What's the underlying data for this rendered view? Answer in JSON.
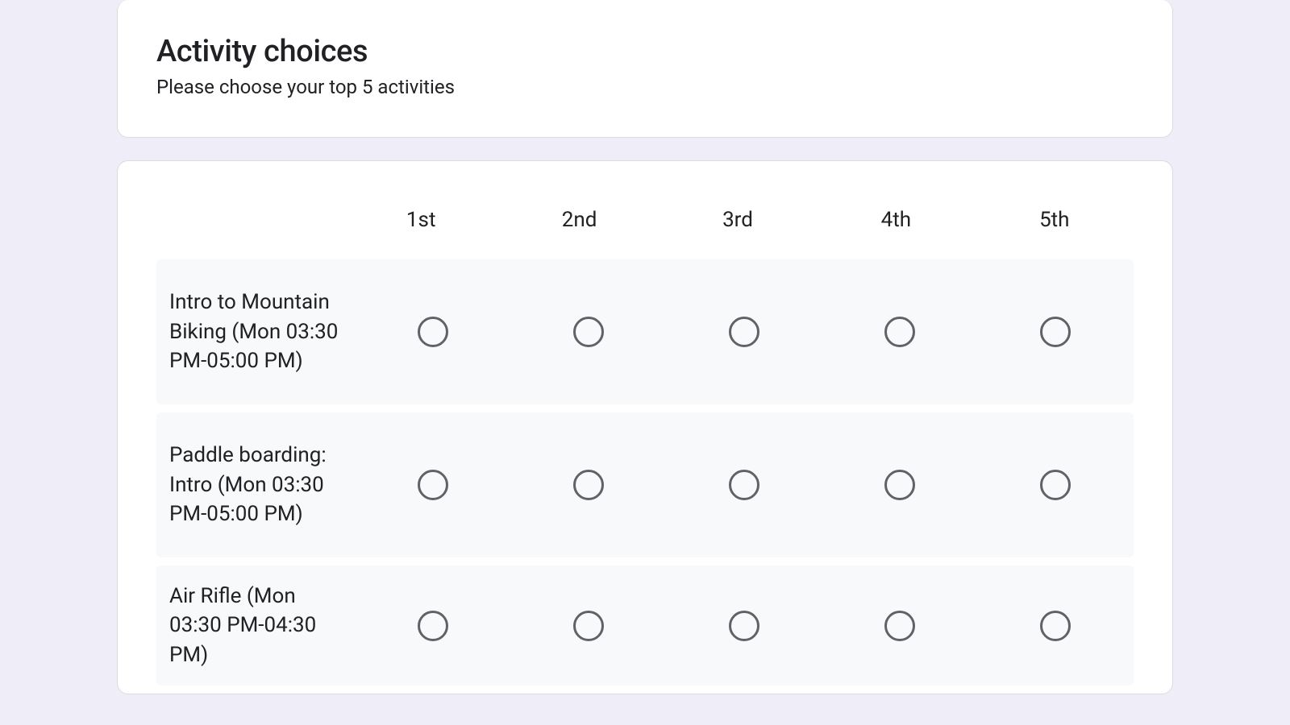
{
  "header": {
    "title": "Activity choices",
    "description": "Please choose your top 5 activities"
  },
  "grid": {
    "columns": [
      "1st",
      "2nd",
      "3rd",
      "4th",
      "5th"
    ],
    "rows": [
      {
        "label": "Intro to Mountain Biking (Mon 03:30 PM-05:00 PM)"
      },
      {
        "label": "Paddle boarding: Intro (Mon 03:30 PM-05:00 PM)"
      },
      {
        "label": "Air Rifle (Mon 03:30 PM-04:30 PM)"
      }
    ]
  }
}
